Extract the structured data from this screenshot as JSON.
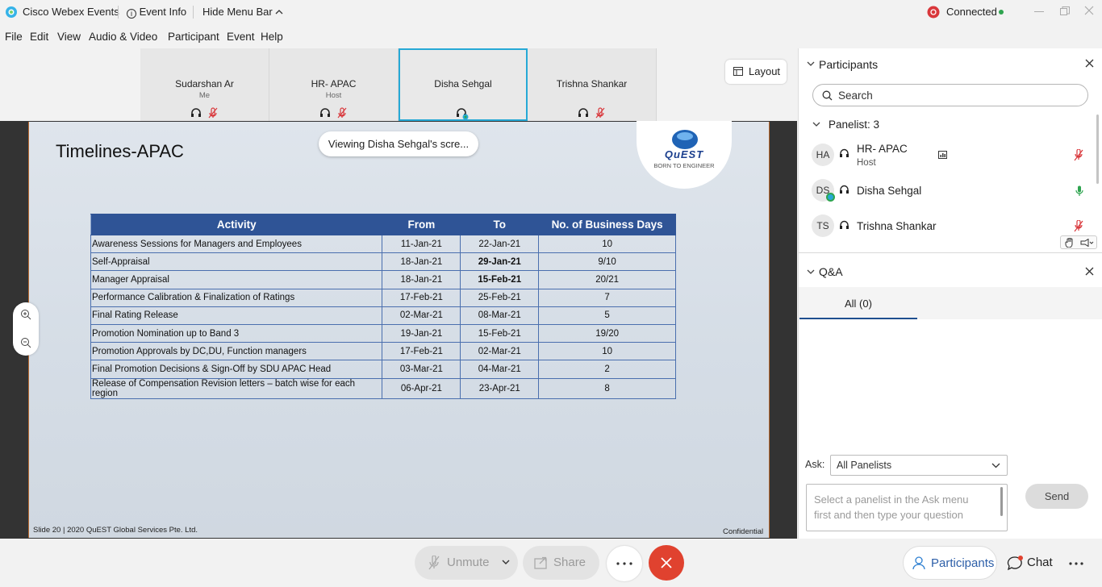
{
  "titlebar": {
    "app_name": "Cisco Webex Events",
    "event_info": "Event Info",
    "hide_menu": "Hide Menu Bar",
    "status": "Connected"
  },
  "menu": [
    "File",
    "Edit",
    "View",
    "Audio & Video",
    "Participant",
    "Event",
    "Help"
  ],
  "video_tiles": [
    {
      "name": "Sudarshan Ar",
      "role": "Me"
    },
    {
      "name": "HR- APAC",
      "role": "Host"
    },
    {
      "name": "Disha Sehgal",
      "role": ""
    },
    {
      "name": "Trishna Shankar",
      "role": ""
    }
  ],
  "layout_label": "Layout",
  "viewing_toast": "Viewing Disha Sehgal's scre...",
  "slide": {
    "title": "Timelines-APAC",
    "logo_text": "QuEST",
    "logo_tagline": "BORN TO ENGINEER",
    "footer_left": "Slide 20 | 2020 QuEST Global Services Pte. Ltd.",
    "footer_right": "Confidential",
    "table": {
      "headers": [
        "Activity",
        "From",
        "To",
        "No. of Business Days"
      ],
      "rows": [
        [
          "Awareness Sessions for Managers and Employees",
          "11-Jan-21",
          "22-Jan-21",
          "10"
        ],
        [
          "Self-Appraisal",
          "18-Jan-21",
          "29-Jan-21",
          "9/10"
        ],
        [
          "Manager Appraisal",
          "18-Jan-21",
          "15-Feb-21",
          "20/21"
        ],
        [
          "Performance Calibration & Finalization of Ratings",
          "17-Feb-21",
          "25-Feb-21",
          "7"
        ],
        [
          "Final Rating Release",
          "02-Mar-21",
          "08-Mar-21",
          "5"
        ],
        [
          "Promotion Nomination up to Band 3",
          "19-Jan-21",
          "15-Feb-21",
          "19/20"
        ],
        [
          "Promotion Approvals by DC,DU, Function managers",
          "17-Feb-21",
          "02-Mar-21",
          "10"
        ],
        [
          "Final Promotion Decisions & Sign-Off by SDU APAC Head",
          "03-Mar-21",
          "04-Mar-21",
          "2"
        ],
        [
          "Release of Compensation Revision letters – batch wise for each region",
          "06-Apr-21",
          "23-Apr-21",
          "8"
        ]
      ]
    }
  },
  "controls": {
    "unmute": "Unmute",
    "share": "Share",
    "participants": "Participants",
    "chat": "Chat"
  },
  "participants_panel": {
    "title": "Participants",
    "search_placeholder": "Search",
    "panelist_header": "Panelist: 3",
    "list": [
      {
        "initials": "HA",
        "name": "HR- APAC",
        "role": "Host"
      },
      {
        "initials": "DS",
        "name": "Disha Sehgal",
        "role": ""
      },
      {
        "initials": "TS",
        "name": "Trishna Shankar",
        "role": ""
      }
    ]
  },
  "qa_panel": {
    "title": "Q&A",
    "tab_all": "All (0)",
    "ask_label": "Ask:",
    "ask_select": "All Panelists",
    "question_placeholder": "Select a panelist in the Ask menu first and then type your question",
    "send": "Send"
  },
  "colors": {
    "accent_blue": "#26a9d6",
    "table_header": "#2f5496",
    "end_call": "#e0422f",
    "mute_red": "#d9373b",
    "mic_green": "#2ea44f",
    "connected_green": "#2ea44f"
  }
}
